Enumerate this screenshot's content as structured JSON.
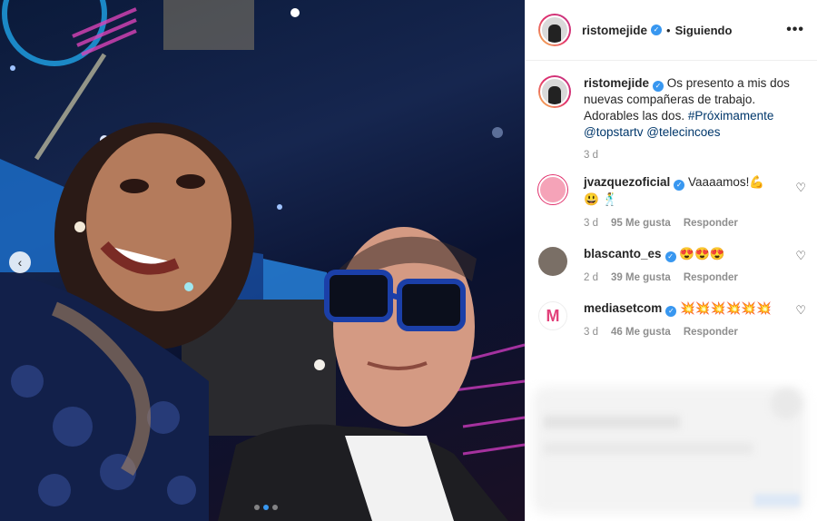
{
  "post": {
    "username": "ristomejide",
    "follow_status": "Siguiendo",
    "separator": "•",
    "more_label": "•••",
    "caption": {
      "text": "Os presento a mis dos nuevas compañeras de trabajo. Adorables las dos.",
      "hashtag": "#Próximamente",
      "mention1": "@topstartv",
      "mention2": "@telecincoes",
      "time": "3 d"
    }
  },
  "comments": [
    {
      "username": "jvazquezoficial",
      "text": "Vaaaamos!💪",
      "text2": "😃 🕺",
      "time": "3 d",
      "likes": "95 Me gusta",
      "reply": "Responder",
      "avatar_color": "#f5a3b8"
    },
    {
      "username": "blascanto_es",
      "text": "😍😍😍",
      "time": "2 d",
      "likes": "39 Me gusta",
      "reply": "Responder",
      "avatar_color": "#7a6f66"
    },
    {
      "username": "mediasetcom",
      "text": "💥💥💥💥💥💥",
      "time": "3 d",
      "likes": "46 Me gusta",
      "reply": "Responder",
      "avatar_color": "#ffffff"
    }
  ],
  "icons": {
    "verified": "✓",
    "heart": "♡",
    "prev": "‹"
  },
  "carousel": {
    "dots": 3,
    "active": 1
  }
}
